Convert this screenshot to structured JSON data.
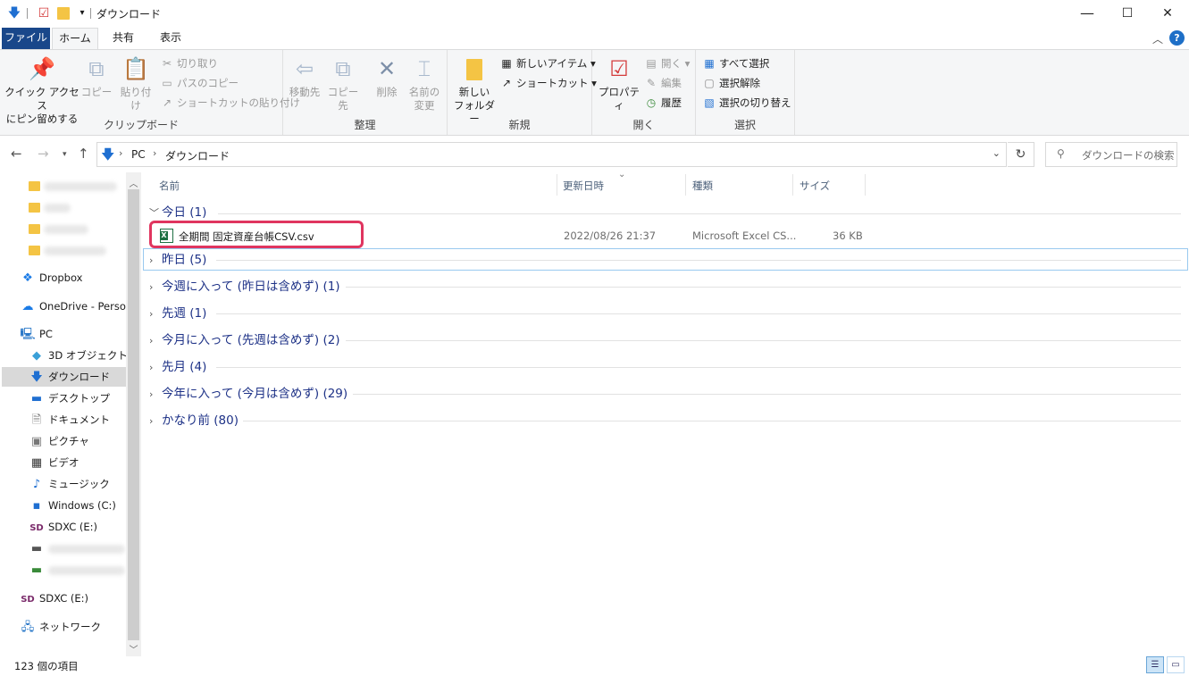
{
  "window": {
    "title": "ダウンロード",
    "minimize_glyph": "—",
    "maximize_glyph": "☐",
    "close_glyph": "✕"
  },
  "ribbon_tabs": [
    "ファイル",
    "ホーム",
    "共有",
    "表示"
  ],
  "ribbon": {
    "clipboard": {
      "group_label": "クリップボード",
      "pin_label_1": "クイック アクセス",
      "pin_label_2": "にピン留めする",
      "copy": "コピー",
      "paste": "貼り付け",
      "cut": "切り取り",
      "copy_path": "パスのコピー",
      "paste_shortcut": "ショートカットの貼り付け"
    },
    "organize": {
      "group_label": "整理",
      "move_to": "移動先",
      "copy_to": "コピー先",
      "delete": "削除",
      "rename_1": "名前の",
      "rename_2": "変更"
    },
    "new": {
      "group_label": "新規",
      "new_folder_1": "新しい",
      "new_folder_2": "フォルダー",
      "new_item": "新しいアイテム",
      "shortcut": "ショートカット"
    },
    "open": {
      "group_label": "開く",
      "properties": "プロパティ",
      "open": "開く",
      "edit": "編集",
      "history": "履歴"
    },
    "select": {
      "group_label": "選択",
      "select_all": "すべて選択",
      "select_none": "選択解除",
      "invert": "選択の切り替え"
    }
  },
  "address": {
    "segments": [
      "PC",
      "ダウンロード"
    ],
    "search_placeholder": "ダウンロードの検索"
  },
  "nav_pane": {
    "dropbox": "Dropbox",
    "onedrive": "OneDrive - Person",
    "pc": "PC",
    "objects3d": "3D オブジェクト",
    "downloads": "ダウンロード",
    "desktop": "デスクトップ",
    "documents": "ドキュメント",
    "pictures": "ピクチャ",
    "videos": "ビデオ",
    "music": "ミュージック",
    "windows_c": "Windows (C:)",
    "sdxc_e": "SDXC (E:)",
    "sdxc_e2": "SDXC (E:)",
    "network": "ネットワーク"
  },
  "columns": {
    "name": "名前",
    "modified": "更新日時",
    "type": "種類",
    "size": "サイズ"
  },
  "groups": [
    {
      "label": "今日 (1)"
    },
    {
      "label": "昨日 (5)"
    },
    {
      "label": "今週に入って (昨日は含めず) (1)"
    },
    {
      "label": "先週 (1)"
    },
    {
      "label": "今月に入って (先週は含めず) (2)"
    },
    {
      "label": "先月 (4)"
    },
    {
      "label": "今年に入って (今月は含めず) (29)"
    },
    {
      "label": "かなり前 (80)"
    }
  ],
  "file": {
    "name": "全期間 固定資産台帳CSV.csv",
    "modified": "2022/08/26 21:37",
    "type": "Microsoft Excel CS...",
    "size": "36 KB"
  },
  "status": {
    "item_count": "123 個の項目"
  },
  "colors": {
    "file_tab": "#19478a",
    "highlight": "#e0355f",
    "group_header": "#1e3287",
    "accent_blue": "#1f6fd1"
  }
}
